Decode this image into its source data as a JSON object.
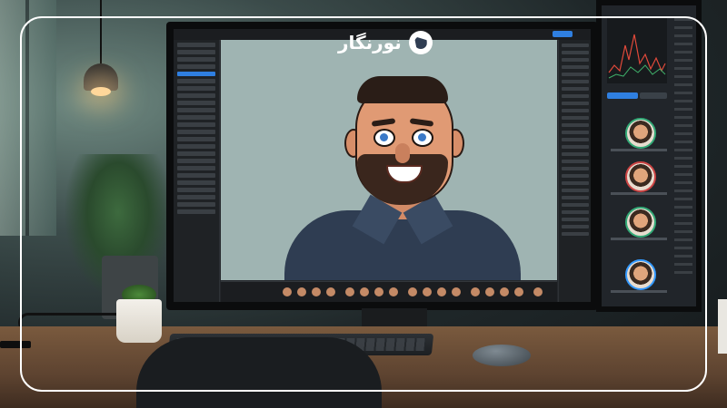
{
  "logo": {
    "text": "نورنگار"
  },
  "monitor": {
    "brand": ""
  },
  "colors": {
    "frame": "#ffffff",
    "accent": "#2f7fe0",
    "shirt": "#2f3d52"
  },
  "icons": [
    "logo-mark-icon"
  ]
}
